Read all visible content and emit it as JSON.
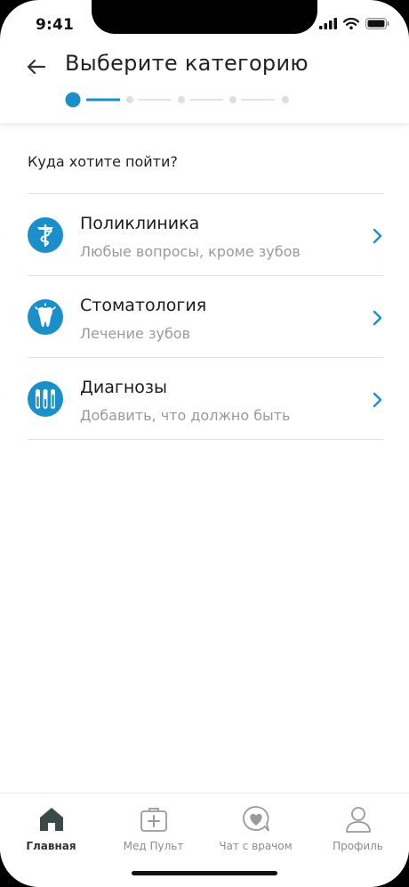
{
  "status": {
    "time": "9:41"
  },
  "header": {
    "title": "Выберите категорию"
  },
  "stepper": {
    "total": 5,
    "current": 1,
    "accent": "#1a8fc9"
  },
  "question": "Куда хотите пойти?",
  "categories": [
    {
      "title": "Поликлиника",
      "subtitle": "Любые вопросы, кроме зубов",
      "icon": "caduceus-icon"
    },
    {
      "title": "Стоматология",
      "subtitle": "Лечение зубов",
      "icon": "tooth-icon"
    },
    {
      "title": "Диагнозы",
      "subtitle": "Добавить, что должно быть",
      "icon": "test-tubes-icon"
    }
  ],
  "tabs": [
    {
      "label": "Главная",
      "icon": "home-icon",
      "active": true
    },
    {
      "label": "Мед Пульт",
      "icon": "medkit-icon",
      "active": false
    },
    {
      "label": "Чат с врачом",
      "icon": "chat-heart-icon",
      "active": false
    },
    {
      "label": "Профиль",
      "icon": "profile-icon",
      "active": false
    }
  ],
  "colors": {
    "accent": "#1a8fc9",
    "text": "#222222",
    "muted": "#9a9a9a",
    "divider": "#e2e2e2"
  }
}
